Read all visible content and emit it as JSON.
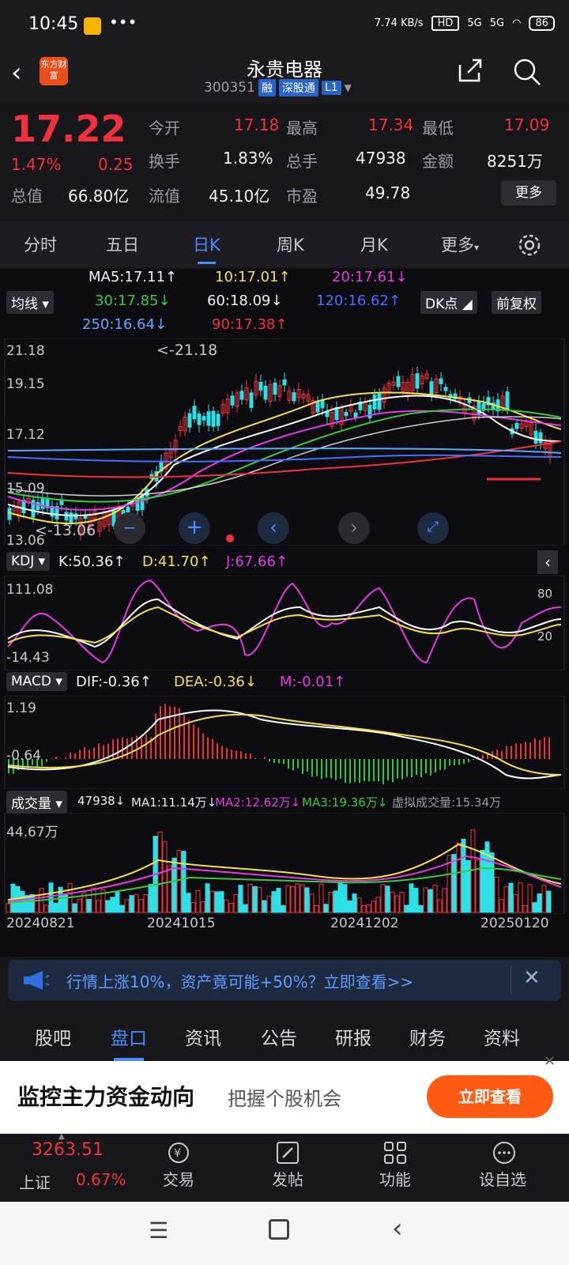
{
  "status": {
    "time": "10:45",
    "speed": "7.74 KB/s",
    "hd": "HD",
    "net1": "5G",
    "net2": "5G",
    "battery": "86"
  },
  "header": {
    "logo": "东方财富",
    "title": "永贵电器",
    "code": "300351",
    "tag1": "融",
    "tag2": "深股通",
    "tag3": "L1"
  },
  "quote": {
    "price": "17.22",
    "pct": "1.47%",
    "chg": "0.25",
    "open_label": "今开",
    "open": "17.18",
    "high_label": "最高",
    "high": "17.34",
    "low_label": "最低",
    "low": "17.09",
    "turnover_label": "换手",
    "turnover": "1.83%",
    "volume_label": "总手",
    "volume": "47938",
    "amount_label": "金额",
    "amount": "8251万",
    "mktcap_label": "总值",
    "mktcap": "66.80亿",
    "float_label": "流值",
    "float": "45.10亿",
    "pe_label": "市盈",
    "pe": "49.78",
    "more_label": "更多"
  },
  "ktabs": [
    "分时",
    "五日",
    "日K",
    "周K",
    "月K",
    "更多"
  ],
  "ma": {
    "ma5": "MA5:17.11↑",
    "ma10": "10:17.01↑",
    "ma20": "20:17.61↓",
    "ma30": "30:17.85↓",
    "ma60": "60:18.09↓",
    "ma120": "120:16.62↑",
    "ma250": "250:16.64↓",
    "ma90": "90:17.38↑",
    "btn_ma": "均线",
    "btn_dk": "DK点",
    "btn_fq": "前复权"
  },
  "axes": {
    "p1": "21.18",
    "p2": "19.15",
    "p3": "17.12",
    "p4": "15.09",
    "p5": "13.06",
    "hi_mark": "<-21.18",
    "lo_mark": "<-13.06"
  },
  "kdj": {
    "name": "KDJ",
    "k": "K:50.36↑",
    "d": "D:41.70↑",
    "j": "J:67.66↑",
    "top": "111.08",
    "bot": "-14.43",
    "r80": "80",
    "r20": "20"
  },
  "macd": {
    "name": "MACD",
    "dif": "DIF:-0.36↑",
    "dea": "DEA:-0.36↓",
    "m": "M:-0.01↑",
    "top": "1.19",
    "bot": "-0.64"
  },
  "vol": {
    "name": "成交量",
    "v": "47938↓",
    "ma1": "MA1:11.14万↓",
    "ma2": "MA2:12.62万↓",
    "ma3": "MA3:19.36万↓",
    "virt": "虚拟成交量:15.34万",
    "top": "44.67万"
  },
  "dates": [
    "20240821",
    "20241015",
    "20241202",
    "20250120"
  ],
  "banner": {
    "text": "行情上涨10%，资产竟可能+50%？立即查看>>"
  },
  "bottomtabs": [
    "股吧",
    "盘口",
    "资讯",
    "公告",
    "研报",
    "财务",
    "资料"
  ],
  "promo": {
    "headline": "监控主力资金动向",
    "sub": "把握个股机会",
    "btn": "立即查看"
  },
  "nav": {
    "index_value": "3263.51",
    "index_name": "上证",
    "index_pct": "0.67%",
    "trade": "交易",
    "post": "发帖",
    "func": "功能",
    "watch": "设自选"
  },
  "colors": {
    "up": "#f0323c",
    "down": "#28c846",
    "accent": "#4a8cff",
    "cyan_candle": "#2ee0e6"
  }
}
